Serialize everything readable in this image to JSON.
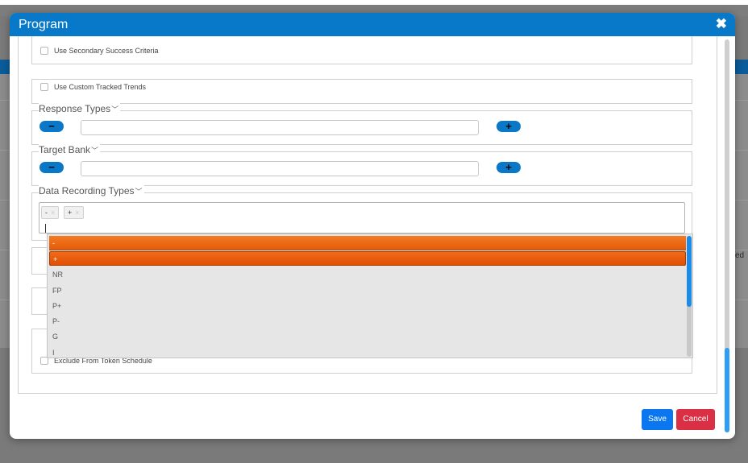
{
  "background": {
    "partial_text": "ed"
  },
  "modal": {
    "title": "Program",
    "close_icon": "close-icon",
    "header_color": "#0879c8"
  },
  "sections": {
    "secondary_success": {
      "label": "Use Secondary Success Criteria",
      "checked": false
    },
    "custom_trends": {
      "label": "Use Custom Tracked Trends",
      "checked": false
    },
    "response_types": {
      "legend": "Response Types",
      "minus": "−",
      "plus": "+",
      "input_value": ""
    },
    "target_bank": {
      "legend": "Target Bank",
      "minus": "−",
      "plus": "+",
      "input_value": ""
    },
    "data_recording": {
      "legend": "Data Recording Types",
      "chips": [
        {
          "label": "-",
          "remove": "×"
        },
        {
          "label": "+",
          "remove": "×"
        }
      ]
    },
    "token_schedule": {
      "label": "Exclude From Token Schedule",
      "checked": false
    }
  },
  "dropdown": {
    "options": [
      "-",
      "+",
      "NR",
      "FP",
      "P+",
      "P-",
      "G",
      "I"
    ],
    "selected_color": "#f47a22"
  },
  "footer": {
    "save_label": "Save",
    "cancel_label": "Cancel",
    "save_color": "#0a77f0",
    "cancel_color": "#db2f45"
  }
}
